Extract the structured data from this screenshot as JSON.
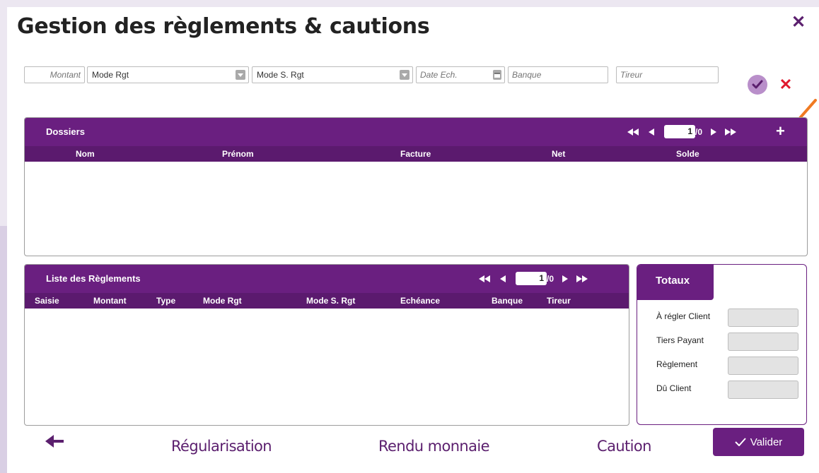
{
  "dialog": {
    "title": "Gestion des règlements & cautions",
    "close_icon": "close-icon"
  },
  "filters": {
    "montant_placeholder": "Montant",
    "mode_rgt": "Mode Rgt",
    "mode_s_rgt": "Mode S. Rgt",
    "date_ech_placeholder": "Date Ech.",
    "banque_placeholder": "Banque",
    "tireur_placeholder": "Tireur"
  },
  "dossiers": {
    "title": "Dossiers",
    "page_current": "1",
    "page_total": "/0",
    "columns": [
      "Nom",
      "Prénom",
      "Facture",
      "Net",
      "Solde"
    ]
  },
  "reglements": {
    "title": "Liste des Règlements",
    "page_current": "1",
    "page_total": "/0",
    "columns": [
      "Saisie",
      "Montant",
      "Type",
      "Mode Rgt",
      "Mode S. Rgt",
      "Echéance",
      "Banque",
      "Tireur"
    ]
  },
  "totaux": {
    "title": "Totaux",
    "rows": [
      "À régler Client",
      "Tiers Payant",
      "Règlement",
      "Dû Client"
    ]
  },
  "footer": {
    "regularisation": "Régularisation",
    "rendu_monnaie": "Rendu monnaie",
    "caution": "Caution",
    "valider": "Valider"
  },
  "colors": {
    "accent": "#6a1f80",
    "header_dark": "#5b1a6e",
    "cancel": "#e0182d",
    "arrow": "#f07a22"
  }
}
